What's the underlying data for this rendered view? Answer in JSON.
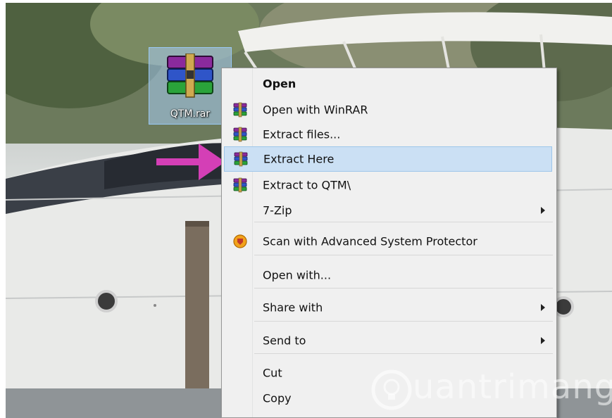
{
  "desktop": {
    "file_label": "QTM.rar",
    "watermark": "uantrimang"
  },
  "context_menu": {
    "items": [
      {
        "label": "Open",
        "icon": "none",
        "bold": true
      },
      {
        "label": "Open with WinRAR",
        "icon": "winrar-icon"
      },
      {
        "label": "Extract files...",
        "icon": "winrar-icon"
      },
      {
        "label": "Extract Here",
        "icon": "winrar-icon",
        "highlighted": true
      },
      {
        "label": "Extract to QTM\\",
        "icon": "winrar-icon"
      },
      {
        "label": "7-Zip",
        "icon": "none",
        "submenu": true
      },
      {
        "label": "Scan with Advanced System Protector",
        "icon": "shield-icon"
      },
      {
        "label": "Open with...",
        "icon": "none"
      },
      {
        "label": "Share with",
        "icon": "none",
        "submenu": true
      },
      {
        "label": "Send to",
        "icon": "none",
        "submenu": true
      },
      {
        "label": "Cut",
        "icon": "none"
      },
      {
        "label": "Copy",
        "icon": "none"
      }
    ]
  },
  "colors": {
    "highlight": "#cbe0f4",
    "pointer_arrow": "#d43fb6"
  }
}
